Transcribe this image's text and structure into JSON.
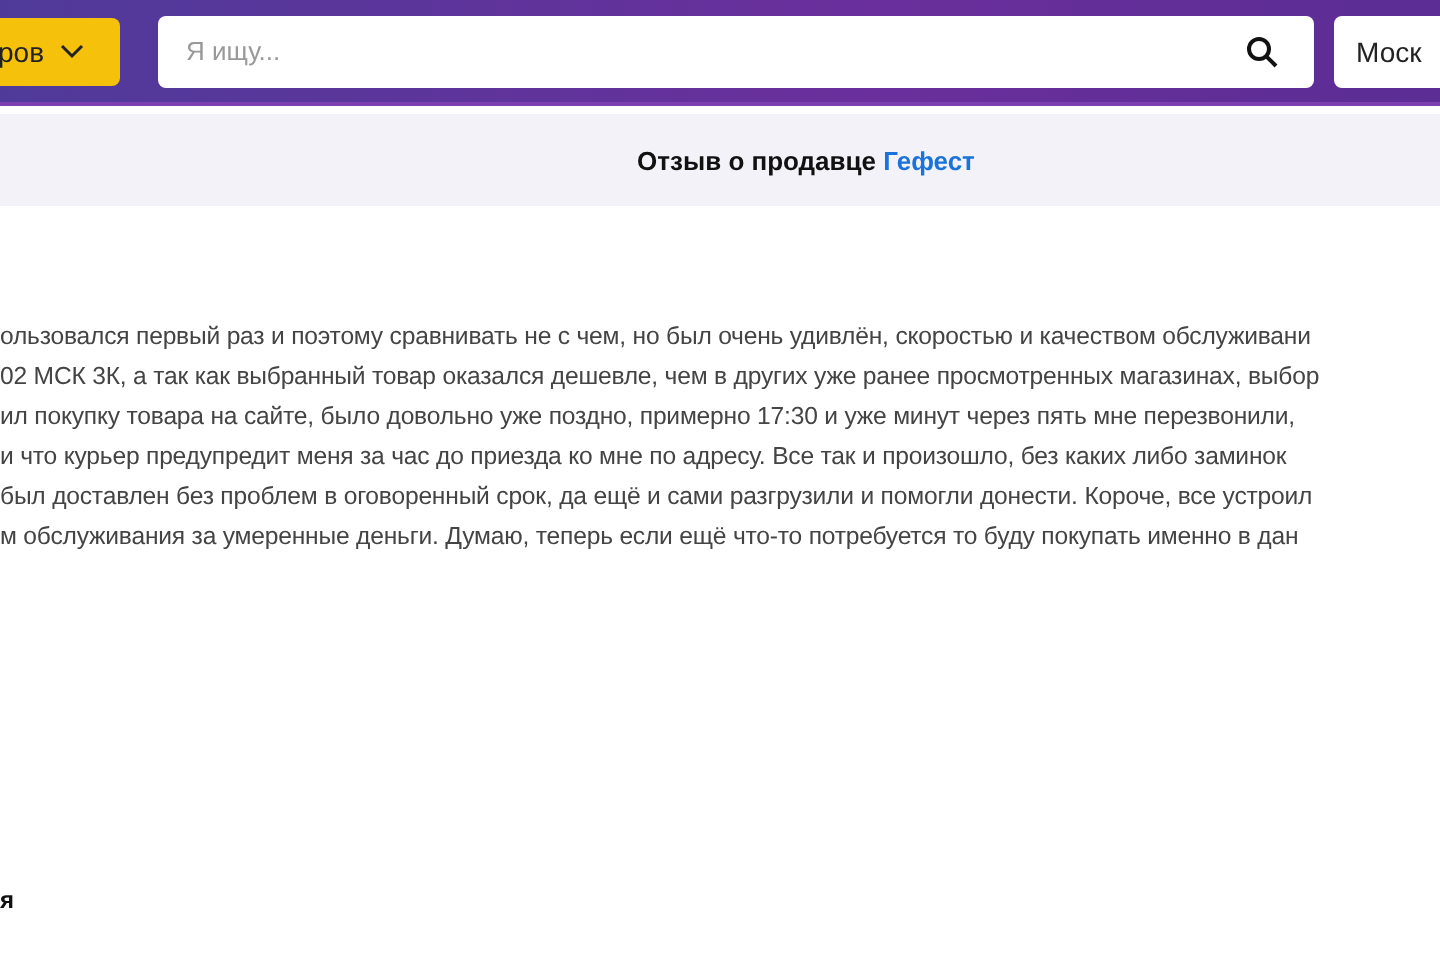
{
  "header": {
    "catalog_button": "ров",
    "search": {
      "placeholder": "Я ищу..."
    },
    "city_button": "Моск"
  },
  "review_title": {
    "text": "Отзыв о продавце ",
    "seller_link": "Гефест"
  },
  "review_lines": [
    "ользовался первый раз и поэтому сравнивать не с чем, но был очень удивлён, скоростью и качеством обслуживани",
    "02 МСК 3К, а так как выбранный товар оказался дешевле, чем в других уже ранее просмотренных магазинах, выбор",
    "ил покупку товара на сайте, было довольно уже поздно, примерно 17:30 и уже минут через пять мне перезвонили,",
    "и что курьер предупредит меня за час до приезда ко мне по адресу. Все так и произошло, без каких либо заминок",
    "был доставлен без проблем в оговоренный срок, да ещё и сами разгрузили и помогли донести. Короче, все устроил",
    "м обслуживания за умеренные деньги. Думаю, теперь если ещё что-то потребуется то буду покупать именно в дан"
  ],
  "footer_fragment": "я"
}
